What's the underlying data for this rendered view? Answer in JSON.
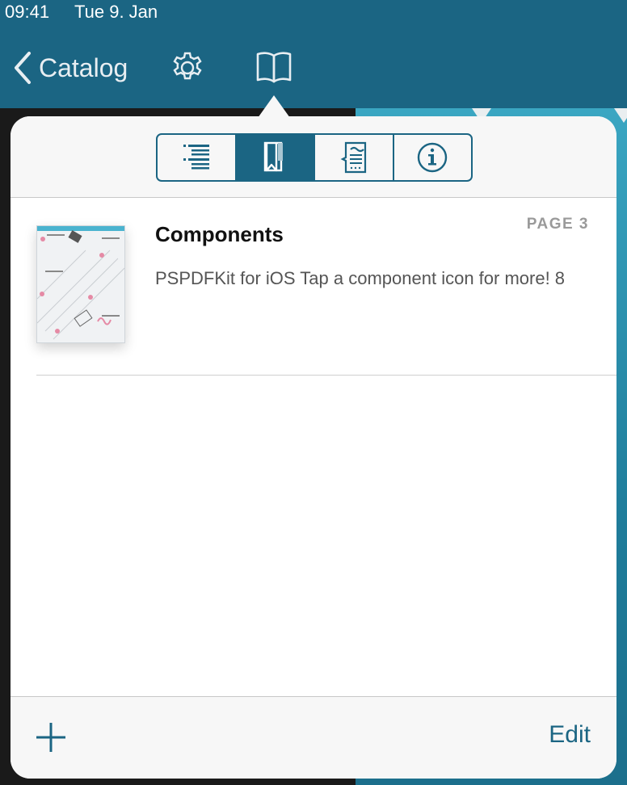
{
  "status": {
    "time": "09:41",
    "date": "Tue 9. Jan"
  },
  "nav": {
    "back_label": "Catalog",
    "settings_icon": "gear-icon",
    "outline_icon": "book-icon"
  },
  "segments": [
    {
      "name": "outline",
      "icon": "list-icon",
      "active": false
    },
    {
      "name": "bookmarks",
      "icon": "bookmark-icon",
      "active": true
    },
    {
      "name": "annotations",
      "icon": "annotation-list-icon",
      "active": false
    },
    {
      "name": "info",
      "icon": "info-icon",
      "active": false
    }
  ],
  "bookmarks": [
    {
      "title": "Components",
      "page": "PAGE 3",
      "description": "PSPDFKit for iOS Tap a component icon for more! 8"
    }
  ],
  "footer": {
    "edit_label": "Edit",
    "add_icon": "plus-icon"
  },
  "colors": {
    "accent": "#1b6583",
    "header_bg": "#f7f7f7"
  }
}
